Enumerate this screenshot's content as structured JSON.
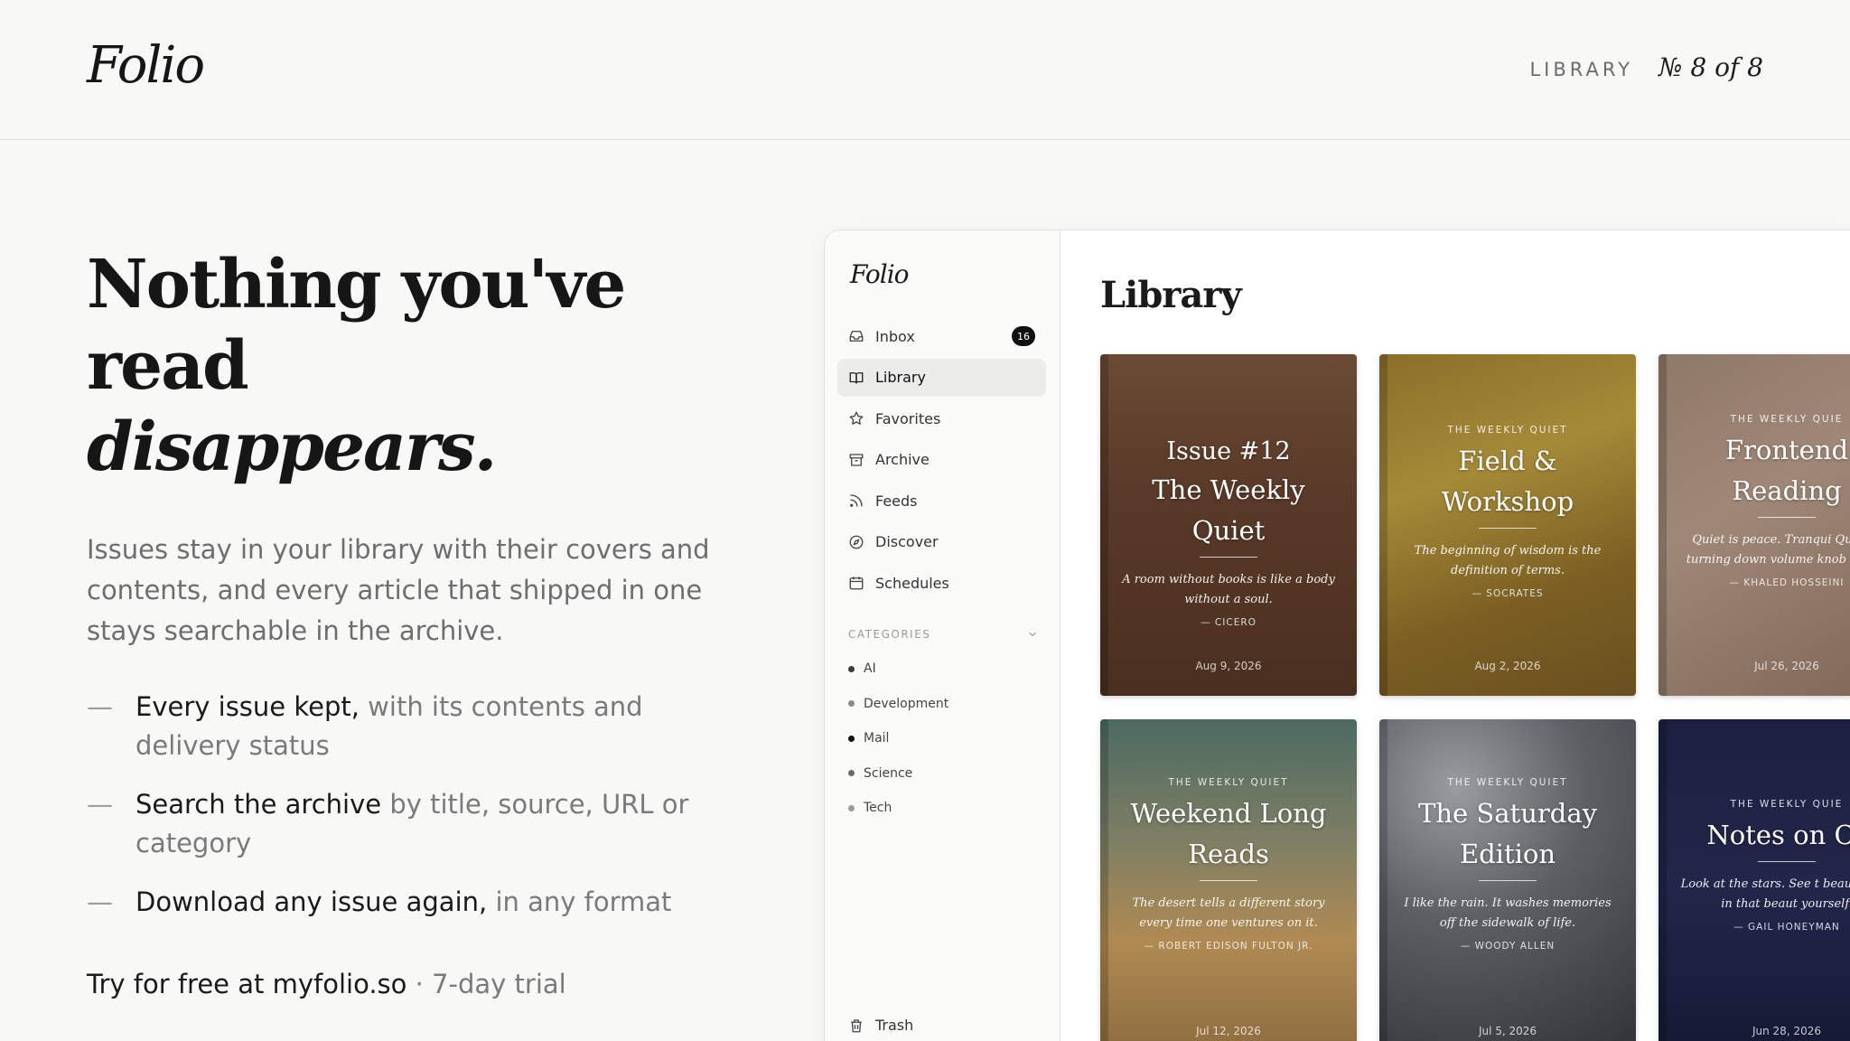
{
  "header": {
    "brand": "Folio",
    "section": "LIBRARY",
    "issue_counter": "№ 8 of 8"
  },
  "hero": {
    "headline_line1": "Nothing you've read",
    "headline_line2": "disappears.",
    "intro": "Issues stay in your library with their covers and contents, and every article that shipped in one stays searchable in the archive.",
    "bullets": [
      {
        "strong": "Every issue kept,",
        "rest": " with its contents and delivery status"
      },
      {
        "strong": "Search the archive",
        "rest": " by title, source, URL or category"
      },
      {
        "strong": "Download any issue again,",
        "rest": " in any format"
      }
    ],
    "cta_strong": "Try for free at myfolio.so",
    "cta_rest": " · 7-day trial"
  },
  "app": {
    "logo": "Folio",
    "nav": [
      {
        "label": "Inbox",
        "icon": "inbox-icon",
        "badge": "16"
      },
      {
        "label": "Library",
        "icon": "book-open-icon",
        "active": true
      },
      {
        "label": "Favorites",
        "icon": "star-icon"
      },
      {
        "label": "Archive",
        "icon": "archive-box-icon"
      },
      {
        "label": "Feeds",
        "icon": "rss-icon"
      },
      {
        "label": "Discover",
        "icon": "compass-icon"
      },
      {
        "label": "Schedules",
        "icon": "calendar-icon"
      }
    ],
    "categories_label": "CATEGORIES",
    "categories": [
      {
        "label": "AI",
        "color": "#3a3a3a"
      },
      {
        "label": "Development",
        "color": "#8a8a8a"
      },
      {
        "label": "Mail",
        "color": "#111111"
      },
      {
        "label": "Science",
        "color": "#6a6a6a"
      },
      {
        "label": "Tech",
        "color": "#9a9a9a"
      }
    ],
    "trash_label": "Trash",
    "main_title": "Library",
    "issues": [
      {
        "eyebrow": "",
        "title_line1": "Issue #12",
        "title_line2": "The Weekly Quiet",
        "quote": "A room without books is like a body without a soul.",
        "author": "— CICERO",
        "date": "Aug 9, 2026"
      },
      {
        "eyebrow": "THE WEEKLY QUIET",
        "title_line1": "Field &",
        "title_line2": "Workshop",
        "quote": "The beginning of wisdom is the definition of terms.",
        "author": "— SOCRATES",
        "date": "Aug 2, 2026"
      },
      {
        "eyebrow": "THE WEEKLY QUIE",
        "title_line1": "Frontend",
        "title_line2": "Reading",
        "quote": "Quiet is peace. Tranqui Quiet is turning down volume knob on life",
        "author": "— KHALED HOSSEINI",
        "date": "Jul 26, 2026"
      },
      {
        "eyebrow": "THE WEEKLY QUIET",
        "title_line1": "Weekend Long",
        "title_line2": "Reads",
        "quote": "The desert tells a different story every time one ventures on it.",
        "author": "— ROBERT EDISON FULTON JR.",
        "date": "Jul 12, 2026"
      },
      {
        "eyebrow": "THE WEEKLY QUIET",
        "title_line1": "The Saturday",
        "title_line2": "Edition",
        "quote": "I like the rain. It washes memories off the sidewalk of life.",
        "author": "— WOODY ALLEN",
        "date": "Jul 5, 2026"
      },
      {
        "eyebrow": "THE WEEKLY QUIE",
        "title_line1": "Notes on Cr",
        "title_line2": "",
        "quote": "Look at the stars. See t beauty. And in that beaut yourself.",
        "author": "— GAIL HONEYMAN",
        "date": "Jun 28, 2026"
      }
    ]
  }
}
